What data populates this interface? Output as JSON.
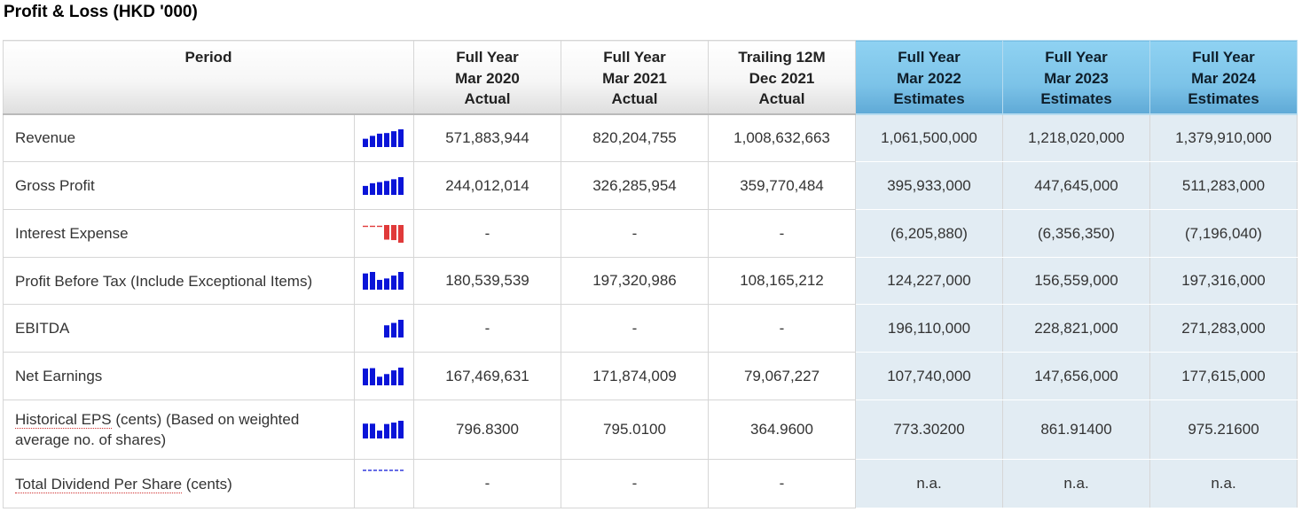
{
  "title": "Profit & Loss (HKD '000)",
  "header": {
    "period": "Period",
    "columns": [
      {
        "line1": "Full Year",
        "line2": "Mar 2020",
        "line3": "Actual"
      },
      {
        "line1": "Full Year",
        "line2": "Mar 2021",
        "line3": "Actual"
      },
      {
        "line1": "Trailing 12M",
        "line2": "Dec 2021",
        "line3": "Actual"
      },
      {
        "line1": "Full Year",
        "line2": "Mar 2022",
        "line3": "Estimates"
      },
      {
        "line1": "Full Year",
        "line2": "Mar 2023",
        "line3": "Estimates"
      },
      {
        "line1": "Full Year",
        "line2": "Mar 2024",
        "line3": "Estimates"
      }
    ]
  },
  "colors": {
    "bar_positive": "#0a14d8",
    "bar_negative": "#e03a3a",
    "estimate_header": "#7cc3e8",
    "estimate_cell": "#e2ecf3"
  },
  "rows": [
    {
      "label": "Revenue",
      "values": [
        "571,883,944",
        "820,204,755",
        "1,008,632,663",
        "1,061,500,000",
        "1,218,020,000",
        "1,379,910,000"
      ],
      "spark": [
        571883944,
        820204755,
        1008632663,
        1061500000,
        1218020000,
        1379910000
      ]
    },
    {
      "label": "Gross Profit",
      "values": [
        "244,012,014",
        "326,285,954",
        "359,770,484",
        "395,933,000",
        "447,645,000",
        "511,283,000"
      ],
      "spark": [
        244012014,
        326285954,
        359770484,
        395933000,
        447645000,
        511283000
      ]
    },
    {
      "label": "Interest Expense",
      "values": [
        "-",
        "-",
        "-",
        "(6,205,880)",
        "(6,356,350)",
        "(7,196,040)"
      ],
      "spark": [
        null,
        null,
        null,
        -6205880,
        -6356350,
        -7196040
      ]
    },
    {
      "label": "Profit Before Tax (Include Exceptional Items)",
      "values": [
        "180,539,539",
        "197,320,986",
        "108,165,212",
        "124,227,000",
        "156,559,000",
        "197,316,000"
      ],
      "spark": [
        180539539,
        197320986,
        108165212,
        124227000,
        156559000,
        197316000
      ]
    },
    {
      "label": "EBITDA",
      "values": [
        "-",
        "-",
        "-",
        "196,110,000",
        "228,821,000",
        "271,283,000"
      ],
      "spark": [
        null,
        null,
        null,
        196110000,
        228821000,
        271283000
      ]
    },
    {
      "label": "Net Earnings",
      "values": [
        "167,469,631",
        "171,874,009",
        "79,067,227",
        "107,740,000",
        "147,656,000",
        "177,615,000"
      ],
      "spark": [
        167469631,
        171874009,
        79067227,
        107740000,
        147656000,
        177615000
      ]
    },
    {
      "label_link": "Historical EPS",
      "label_rest": " (cents) (Based on weighted average no. of shares)",
      "values": [
        "796.8300",
        "795.0100",
        "364.9600",
        "773.30200",
        "861.91400",
        "975.21600"
      ],
      "spark": [
        796.83,
        795.01,
        364.96,
        773.302,
        861.914,
        975.216
      ]
    },
    {
      "label_link": "Total Dividend Per Share",
      "label_rest": " (cents)",
      "values": [
        "-",
        "-",
        "-",
        "n.a.",
        "n.a.",
        "n.a."
      ],
      "spark": [
        null,
        null,
        null,
        null,
        null,
        null
      ]
    }
  ]
}
